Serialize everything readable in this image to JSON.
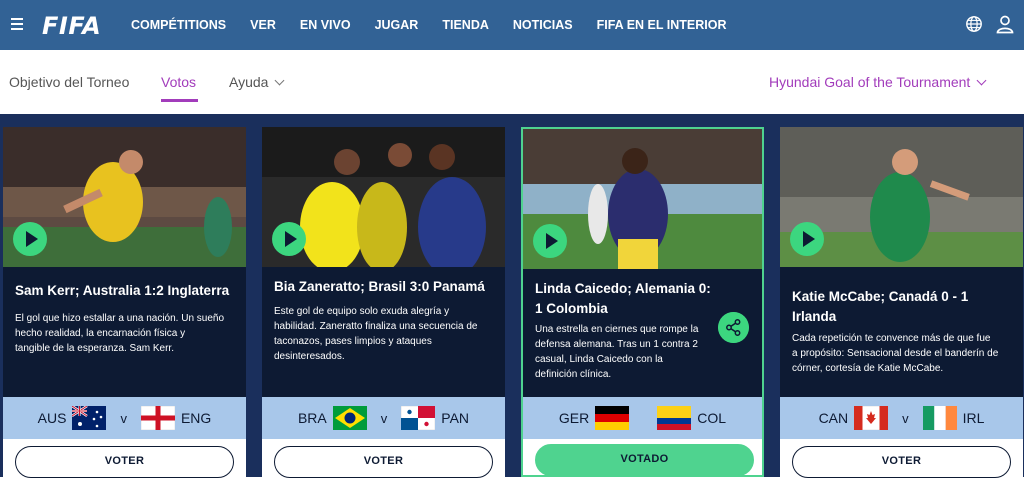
{
  "header": {
    "logo": "FIFA",
    "nav": [
      "COMPÉTITIONS",
      "VER",
      "EN VIVO",
      "JUGAR",
      "TIENDA",
      "NOTICIAS",
      "FIFA EN EL INTERIOR"
    ]
  },
  "subnav": {
    "tabs": [
      {
        "label": "Objetivo del Torneo",
        "active": false
      },
      {
        "label": "Votos",
        "active": true
      },
      {
        "label": "Ayuda",
        "active": false
      }
    ],
    "selector": "Hyundai Goal of the Tournament"
  },
  "cards": [
    {
      "title_lines": [
        "Sam Kerr; Australia 1:2 Inglaterra"
      ],
      "desc_lines": [
        "El gol que hizo estallar a una nación. Un sueño",
        "hecho realidad, la encarnación física y",
        "tangible de la esperanza. Sam Kerr."
      ],
      "home": "AUS",
      "vs": "v",
      "away": "ENG",
      "button": "VOTER"
    },
    {
      "title_lines": [
        "Bia Zaneratto; Brasil 3:0 Panamá"
      ],
      "desc_lines": [
        "Este gol de equipo solo exuda alegría y",
        "habilidad. Zaneratto finaliza una secuencia de",
        "taconazos, pases limpios y ataques",
        "desinteresados."
      ],
      "home": "BRA",
      "vs": "v",
      "away": "PAN",
      "button": "VOTER"
    },
    {
      "title_lines": [
        "Linda Caicedo; Alemania 0:",
        "1 Colombia"
      ],
      "desc_lines": [
        "Una estrella en ciernes que rompe la",
        "defensa alemana. Tras un 1 contra 2",
        "casual, Linda Caicedo con la",
        "definición clínica."
      ],
      "home": "GER",
      "vs": "",
      "away": "COL",
      "button": "VOTADO"
    },
    {
      "title_lines": [
        "Katie McCabe; Canadá 0 - 1",
        "Irlanda"
      ],
      "desc_lines": [
        "Cada repetición te convence más de que fue",
        "a propósito: Sensacional desde el banderín de",
        "córner, cortesía de Katie McCabe."
      ],
      "home": "CAN",
      "vs": "v",
      "away": "IRL",
      "button": "VOTER"
    }
  ],
  "colors": {
    "nav_bg": "#326295",
    "accent_purple": "#a23cbb",
    "card_dark": "#0d1a33",
    "match_bar": "#a8c7ea",
    "green": "#4fd38f"
  }
}
